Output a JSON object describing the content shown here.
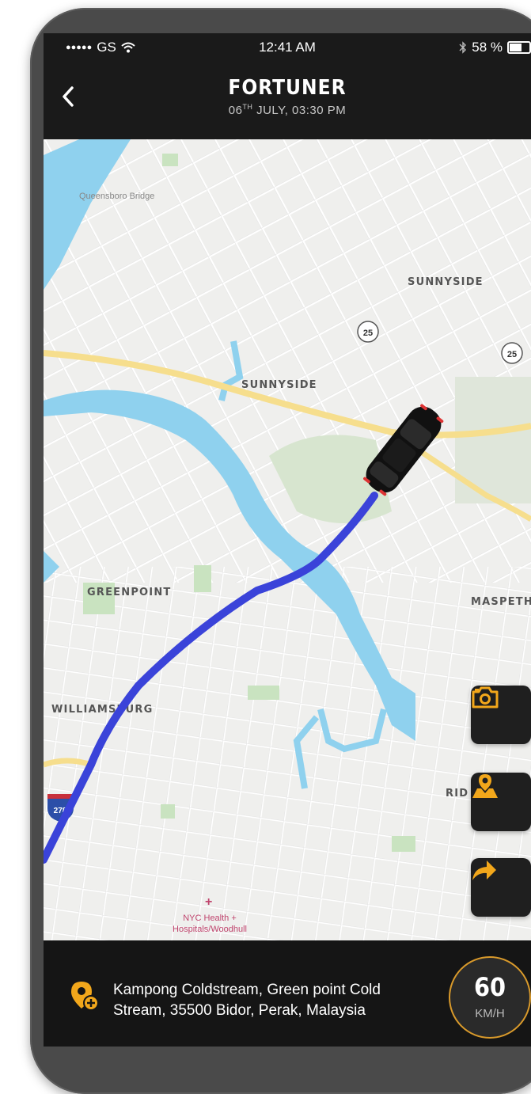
{
  "status_bar": {
    "carrier": "GS",
    "time": "12:41 AM",
    "battery": "58 %"
  },
  "header": {
    "title": "FORTUNER",
    "subtitle_day": "06",
    "subtitle_sup": "TH",
    "subtitle_rest": " JULY, 03:30 PM"
  },
  "map": {
    "labels": {
      "queensboro": "Queensboro Bridge",
      "sunnyside_1": "SUNNYSIDE",
      "sunnyside_2": "SUNNYSIDE",
      "greenpoint": "GREENPOINT",
      "williamsburg": "WILLIAMSBURG",
      "maspeth": "MASPETH",
      "ridgewood": "RID",
      "nyc_health_1": "NYC Health +",
      "nyc_health_2": "Hospitals/Woodhull",
      "route_25_a": "25",
      "route_25_b": "25",
      "interstate": "278"
    },
    "colors": {
      "water": "#8fd1ee",
      "park": "#cfe5c7",
      "highway": "#f6de8d",
      "route": "#3a43d9"
    }
  },
  "actions": {
    "camera_icon": "camera-icon",
    "map_pin_icon": "map-location-icon",
    "share_icon": "share-arrow-icon",
    "accent": "#f2a71b"
  },
  "footer": {
    "address_line1": "Kampong Coldstream, Green point Cold",
    "address_line2": "Stream, 35500 Bidor, Perak, Malaysia",
    "speed_value": "60",
    "speed_unit": "KM/H"
  }
}
